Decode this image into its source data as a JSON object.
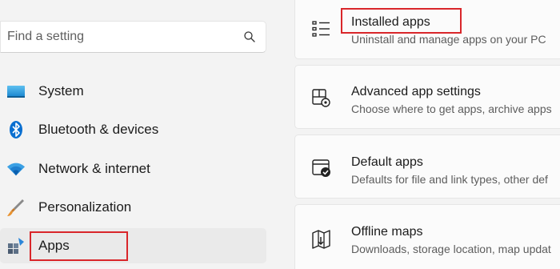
{
  "search": {
    "placeholder": "Find a setting",
    "icon": "search-icon"
  },
  "sidebar": {
    "items": [
      {
        "label": "System",
        "icon": "monitor-icon"
      },
      {
        "label": "Bluetooth & devices",
        "icon": "bluetooth-icon"
      },
      {
        "label": "Network & internet",
        "icon": "wifi-icon"
      },
      {
        "label": "Personalization",
        "icon": "brush-icon"
      },
      {
        "label": "Apps",
        "icon": "apps-icon",
        "selected": true
      }
    ]
  },
  "main": {
    "cards": [
      {
        "title": "Installed apps",
        "description": "Uninstall and manage apps on your PC",
        "icon": "list-icon"
      },
      {
        "title": "Advanced app settings",
        "description": "Choose where to get apps, archive apps",
        "icon": "app-settings-icon"
      },
      {
        "title": "Default apps",
        "description": "Defaults for file and link types, other def",
        "icon": "default-apps-icon"
      },
      {
        "title": "Offline maps",
        "description": "Downloads, storage location, map updat",
        "icon": "map-icon"
      }
    ]
  },
  "colors": {
    "accent": "#005fb8",
    "highlight": "#d9262a",
    "background": "#f3f3f3",
    "card": "#fbfbfb"
  }
}
